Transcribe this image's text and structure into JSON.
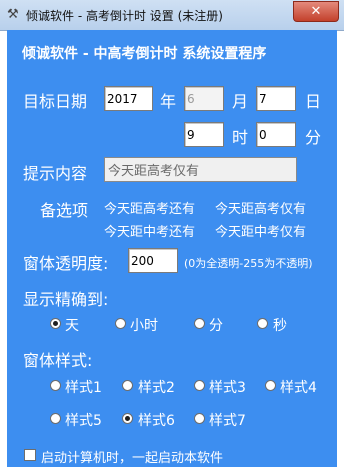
{
  "window": {
    "title": "倾诚软件 - 高考倒计时 设置 (未注册)",
    "close_glyph": "✕",
    "app_icon": "tool-icon"
  },
  "header": {
    "title": "倾诚软件 - 中高考倒计时 系统设置程序"
  },
  "target_date": {
    "label": "目标日期",
    "year_value": "2017",
    "year_unit": "年",
    "month_value": "6",
    "month_unit": "月",
    "day_value": "7",
    "day_unit": "日",
    "hour_value": "9",
    "hour_unit": "时",
    "minute_value": "0",
    "minute_unit": "分"
  },
  "prompt": {
    "label": "提示内容",
    "value": "今天距高考仅有"
  },
  "options": {
    "label": "备选项",
    "items": [
      "今天距高考还有",
      "今天距高考仅有",
      "今天距中考还有",
      "今天距中考仅有"
    ]
  },
  "opacity": {
    "label": "窗体透明度:",
    "value": "200",
    "hint": "(0为全透明-255为不透明)"
  },
  "precision": {
    "label": "显示精确到:",
    "choices": [
      "天",
      "小时",
      "分",
      "秒"
    ],
    "selected": "天"
  },
  "style": {
    "label": "窗体样式:",
    "choices": [
      "样式1",
      "样式2",
      "样式3",
      "样式4",
      "样式5",
      "样式6",
      "样式7"
    ],
    "selected": "样式6"
  },
  "autostart": {
    "label": "启动计算机时，一起启动本软件",
    "checked": false
  },
  "colors": {
    "panel": "#3d8ef0",
    "text": "#ffffff"
  }
}
